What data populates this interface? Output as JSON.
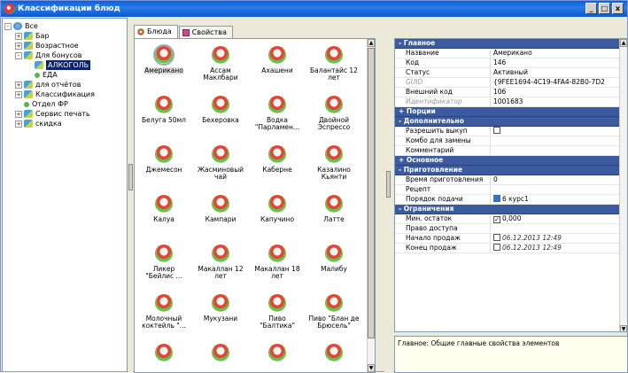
{
  "window": {
    "title": "Классификации блюд",
    "btn_min": "_",
    "btn_max": "□",
    "btn_close": "x"
  },
  "tree": [
    {
      "label": "Все",
      "level": 0,
      "pm": "-",
      "icon": "glob"
    },
    {
      "label": "Бар",
      "level": 1,
      "pm": "+",
      "icon": "folder"
    },
    {
      "label": "Возрастное",
      "level": 1,
      "pm": "+",
      "icon": "folder"
    },
    {
      "label": "Для бонусов",
      "level": 1,
      "pm": "-",
      "icon": "folder"
    },
    {
      "label": "АЛКОГОЛЬ",
      "level": 2,
      "pm": "",
      "icon": "folder",
      "selected": true
    },
    {
      "label": "ЕДА",
      "level": 2,
      "pm": "",
      "icon": "leaf"
    },
    {
      "label": "для отчётов",
      "level": 1,
      "pm": "+",
      "icon": "folder"
    },
    {
      "label": "Классификация",
      "level": 1,
      "pm": "+",
      "icon": "folder"
    },
    {
      "label": "Отдел ФР",
      "level": 1,
      "pm": "",
      "icon": "leaf"
    },
    {
      "label": "Сервис печать",
      "level": 1,
      "pm": "+",
      "icon": "folder"
    },
    {
      "label": "скидка",
      "level": 1,
      "pm": "+",
      "icon": "folder"
    }
  ],
  "tabs": [
    {
      "label": "Блюда",
      "active": true
    },
    {
      "label": "Свойства",
      "active": false
    }
  ],
  "dishes": [
    {
      "name": "Американо",
      "selected": true
    },
    {
      "name": "Ассам Маклбари"
    },
    {
      "name": "Ахашени"
    },
    {
      "name": "Балантайс 12 лет"
    },
    {
      "name": "Белуга 50мл"
    },
    {
      "name": "Бехеровка"
    },
    {
      "name": "Водка \"Парламен..."
    },
    {
      "name": "Двойной Эспрессо"
    },
    {
      "name": "Джемесон"
    },
    {
      "name": "Жасминовый чай"
    },
    {
      "name": "Каберне"
    },
    {
      "name": "Казалино Кьянти"
    },
    {
      "name": "Калуа"
    },
    {
      "name": "Кампари"
    },
    {
      "name": "Капучино"
    },
    {
      "name": "Латте"
    },
    {
      "name": "Ликер \"Бейлис ..."
    },
    {
      "name": "Макаллан 12 лет"
    },
    {
      "name": "Макаллан 18 лет"
    },
    {
      "name": "Малибу"
    },
    {
      "name": "Молочный коктейль \"..."
    },
    {
      "name": "Мукузани"
    },
    {
      "name": "Пиво \"Балтика\""
    },
    {
      "name": "Пиво \"Блан де Брюсель\""
    },
    {
      "name": ""
    },
    {
      "name": ""
    },
    {
      "name": ""
    },
    {
      "name": ""
    }
  ],
  "props": [
    {
      "type": "cat",
      "label": "Главное",
      "sign": "-"
    },
    {
      "key": "Название",
      "value": "Американо"
    },
    {
      "key": "Код",
      "value": "146"
    },
    {
      "key": "Статус",
      "value": "Активный"
    },
    {
      "key": "GUID",
      "value": "{9FEE1694-4C19-4FA4-82B0-7D2",
      "dis": true
    },
    {
      "key": "Внешний код",
      "value": "106"
    },
    {
      "key": "Идентификатор",
      "value": "1001683",
      "dis": true
    },
    {
      "type": "cat",
      "label": "Порции",
      "sign": "+"
    },
    {
      "type": "cat",
      "label": "Дополнительно",
      "sign": "-"
    },
    {
      "key": "Разрешить выкуп",
      "value": "",
      "cb": " "
    },
    {
      "key": "Комбо для замены",
      "value": ""
    },
    {
      "key": "Комментарий",
      "value": ""
    },
    {
      "type": "cat",
      "label": "Основное",
      "sign": "+"
    },
    {
      "type": "cat",
      "label": "Приготовление",
      "sign": "-"
    },
    {
      "key": "Время приготовления",
      "value": "0"
    },
    {
      "key": "Рецепт",
      "value": ""
    },
    {
      "key": "Порядок подачи",
      "value": "6 курс1",
      "sico": true
    },
    {
      "type": "cat",
      "label": "Ограничения",
      "sign": "-"
    },
    {
      "key": "Мин. остаток",
      "value": "0,000",
      "cb": "✓"
    },
    {
      "key": "Право доступа",
      "value": ""
    },
    {
      "key": "Начало продаж",
      "value": "06.12.2013 12:49",
      "cb": " ",
      "it": true
    },
    {
      "key": "Конец продаж",
      "value": "06.12.2013 12:49",
      "cb": " ",
      "it": true
    }
  ],
  "description": "Главное: Общие главные свойства элементов"
}
